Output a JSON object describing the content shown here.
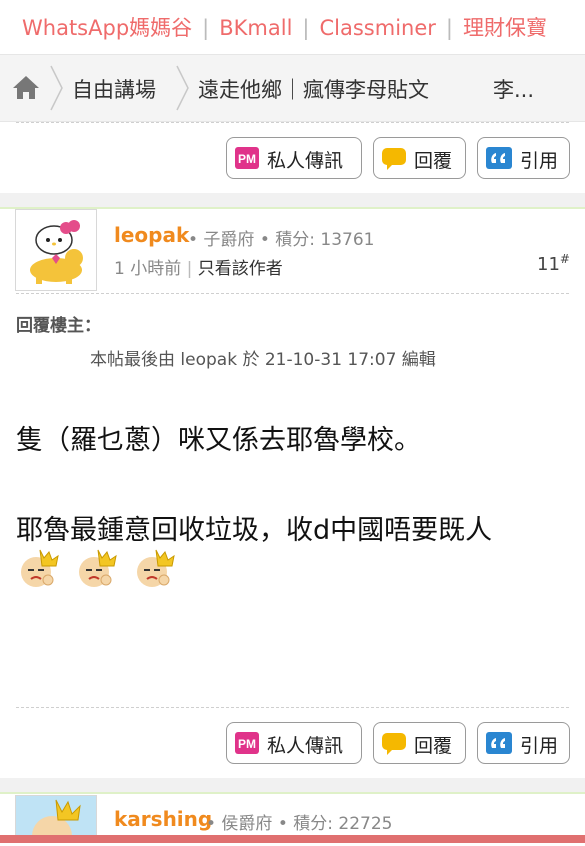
{
  "topnav": {
    "links": [
      "WhatsApp媽媽谷",
      "BKmall",
      "Classminer",
      "理財保寶"
    ]
  },
  "breadcrumb": {
    "items": [
      "自由講場",
      "遠走他鄉｜瘋傳李母貼文",
      "李..."
    ]
  },
  "actions": {
    "pm": "私人傳訊",
    "reply": "回覆",
    "quote": "引用"
  },
  "post": {
    "author": "leopak",
    "meta": "• 子爵府 • 積分: 13761",
    "time": "1 小時前",
    "only_author": "只看該作者",
    "floor": "11",
    "floor_sup": "#",
    "reply_title": "回覆樓主：",
    "edit_note": "本帖最後由 leopak 於 21-10-31 17:07 編輯",
    "line1": "隻（羅乜蔥）咪又係去耶魯學校。",
    "line2": "耶魯最鍾意回收垃圾，收d中國唔要既人"
  },
  "next_post": {
    "author": "karshing",
    "meta": "• 侯爵府 • 積分: 22725"
  },
  "colors": {
    "link": "#ef6b6b",
    "username": "#f08a1e",
    "pm_icon": "#e0338a",
    "reply_icon": "#f5b800",
    "quote_icon": "#2a86d1"
  }
}
